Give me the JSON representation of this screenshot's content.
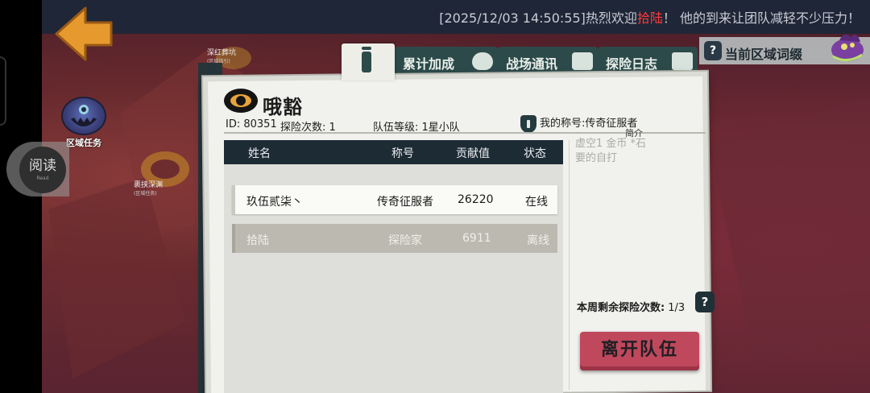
{
  "announcement": {
    "prefix": "[2025/12/03 14:50:55]热烈欢迎",
    "highlight_name": "拾陆",
    "suffix": "！ 他的到来让团队减轻不少压力！"
  },
  "map": {
    "label_top": "深红葬坑",
    "label_top_sub": "(区域指引)",
    "label_mid": "裹挟深渊",
    "label_mid_sub": "(区域任务)",
    "region_task": "区域任务"
  },
  "read_widget": {
    "label": "阅读",
    "sub": "Read"
  },
  "tabs": [
    {
      "label": "",
      "icon": "info-icon",
      "active": true
    },
    {
      "label": "累计加成",
      "icon": "mask-icon"
    },
    {
      "label": "战场通讯",
      "icon": "chat-icon"
    },
    {
      "label": "探险日志",
      "icon": "pen-icon"
    }
  ],
  "current_region": {
    "label": "当前区域词缀",
    "icon": "question-icon"
  },
  "team": {
    "name": "哦豁",
    "id_text": "ID: 80351",
    "explore_count_text": "探险次数: 1",
    "level_text": "队伍等级: 1星小队",
    "my_title_text": "我的称号:传奇征服者",
    "intro_label": "简介",
    "intro_text": "虚空1 金币 *石要的自打"
  },
  "table": {
    "headers": [
      "姓名",
      "称号",
      "贡献值",
      "状态"
    ],
    "rows": [
      {
        "name": "玖伍贰柒丶",
        "title": "传奇征服者",
        "contribution": "26220",
        "status": "在线"
      },
      {
        "name": "拾陆",
        "title": "探险家",
        "contribution": "6911",
        "status": "离线"
      }
    ]
  },
  "remaining": {
    "label": "本周剩余探险次数:",
    "value": "1/3"
  },
  "leave_button": "离开队伍",
  "colors": {
    "accent_teal": "#2d4a4a",
    "leave_button": "#c0485c",
    "announcement_highlight": "#ff3b3b",
    "back_arrow": "#e69a2e"
  }
}
